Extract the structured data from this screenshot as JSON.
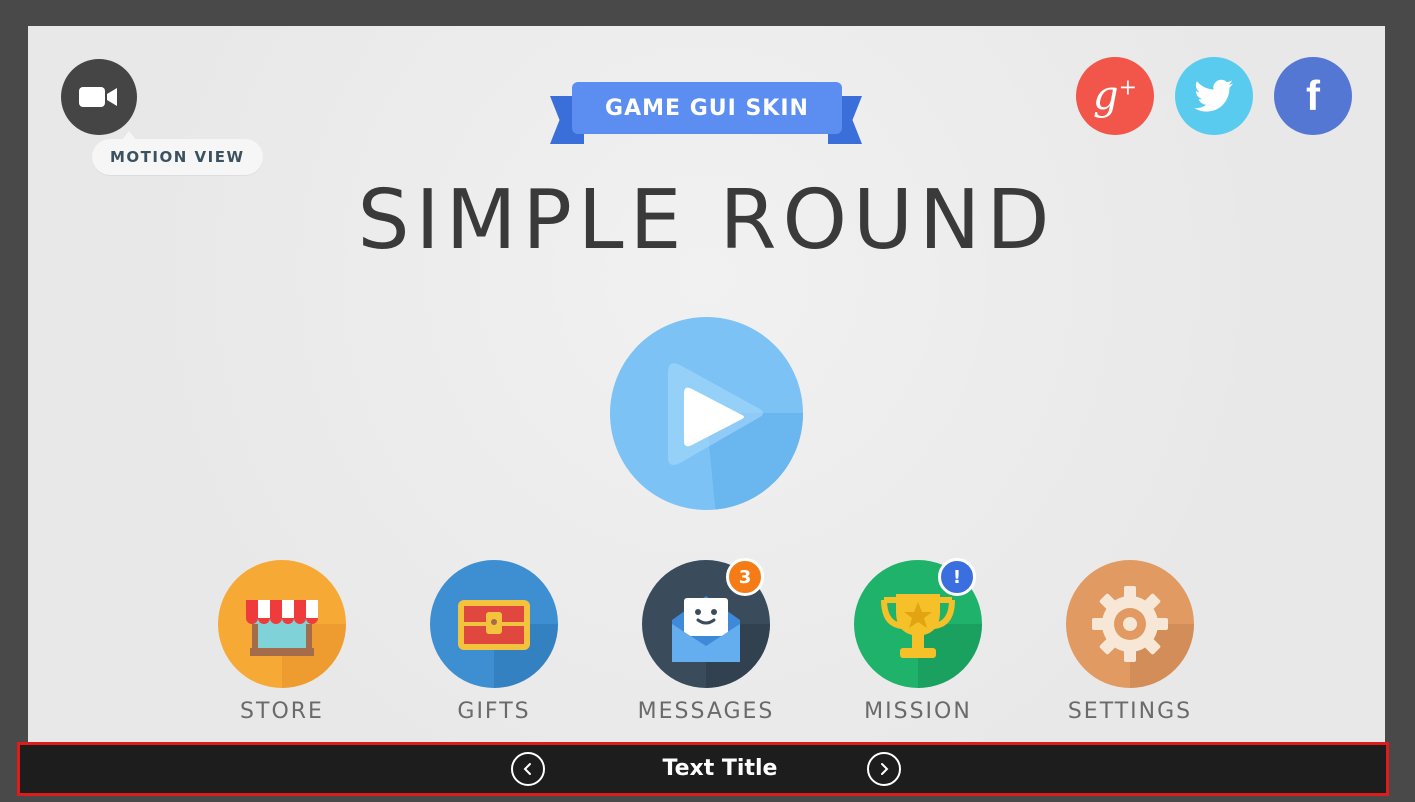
{
  "header": {
    "motion_button": {
      "icon": "video-camera-icon",
      "tooltip": "MOTION VIEW"
    },
    "ribbon_label": "GAME GUI SKIN",
    "title": "SIMPLE ROUND"
  },
  "social": [
    {
      "name": "google-plus",
      "icon": "google-plus-icon",
      "glyph": "g",
      "color": "#f2564b"
    },
    {
      "name": "twitter",
      "icon": "twitter-bird-icon",
      "color": "#59cbee"
    },
    {
      "name": "facebook",
      "icon": "facebook-icon",
      "glyph": "f",
      "color": "#5577d4"
    }
  ],
  "play_button": {
    "icon": "play-icon",
    "color": "#7cc2f5"
  },
  "menu": [
    {
      "label": "STORE",
      "icon": "store-awning-icon",
      "color": "#f7a935"
    },
    {
      "label": "GIFTS",
      "icon": "treasure-chest-icon",
      "color": "#3d8fd1"
    },
    {
      "label": "MESSAGES",
      "icon": "envelope-icon",
      "color": "#3a4b5c",
      "badge": "3",
      "badge_color": "#f47b16"
    },
    {
      "label": "MISSION",
      "icon": "trophy-icon",
      "color": "#1fb26b",
      "badge": "!",
      "badge_color": "#3b6fe0"
    },
    {
      "label": "SETTINGS",
      "icon": "gear-icon",
      "color": "#e09a62"
    }
  ],
  "bottom_bar": {
    "title": "Text Title",
    "prev_icon": "chevron-left-icon",
    "next_icon": "chevron-right-icon",
    "highlight_color": "#e01b1b"
  }
}
